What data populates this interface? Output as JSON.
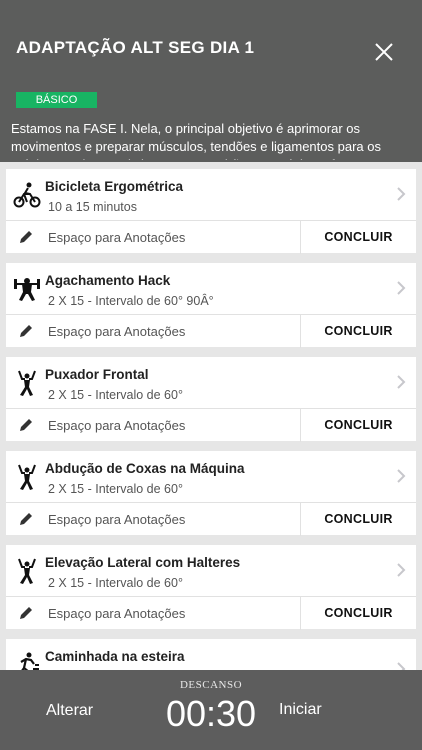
{
  "header": {
    "title": "ADAPTAÇÃO ALT SEG DIA 1",
    "close_icon": "close-icon",
    "level_badge": "BÁSICO",
    "description": "Estamos na FASE I. Nela, o principal objetivo é aprimorar os movimentos e preparar músculos, tendões e ligamentos para os próximos treinos mais intensos que virão nas próximas fases."
  },
  "exercises": [
    {
      "name": "Bicicleta Ergométrica",
      "detail": "10 a 15 minutos",
      "icon": "bicycle-icon",
      "notes_placeholder": "Espaço para Anotações",
      "action": "CONCLUIR"
    },
    {
      "name": "Agachamento Hack",
      "detail": "2 X 15 - Intervalo de 60° 90Â°",
      "icon": "weightlifting-icon",
      "notes_placeholder": "Espaço para Anotações",
      "action": "CONCLUIR"
    },
    {
      "name": "Puxador Frontal",
      "detail": "2 X 15 - Intervalo de 60°",
      "icon": "exercise-figure-icon",
      "notes_placeholder": "Espaço para Anotações",
      "action": "CONCLUIR"
    },
    {
      "name": "Abdução de Coxas na Máquina",
      "detail": "2 X 15 - Intervalo de 60°",
      "icon": "exercise-figure-icon",
      "notes_placeholder": "Espaço para Anotações",
      "action": "CONCLUIR"
    },
    {
      "name": "Elevação Lateral com Halteres",
      "detail": "2 X 15 - Intervalo de 60°",
      "icon": "exercise-figure-icon",
      "notes_placeholder": "Espaço para Anotações",
      "action": "CONCLUIR"
    },
    {
      "name": "Caminhada na esteira",
      "icon": "running-icon"
    }
  ],
  "footer": {
    "left_button": "Alterar",
    "rest_label": "DESCANSO",
    "timer": "00:30",
    "right_button": "Iniciar"
  },
  "colors": {
    "header_bg": "#5c5d5c",
    "badge_green": "#18b463",
    "footer_bg": "#5d5d5d",
    "list_bg": "#e6e6e6"
  }
}
